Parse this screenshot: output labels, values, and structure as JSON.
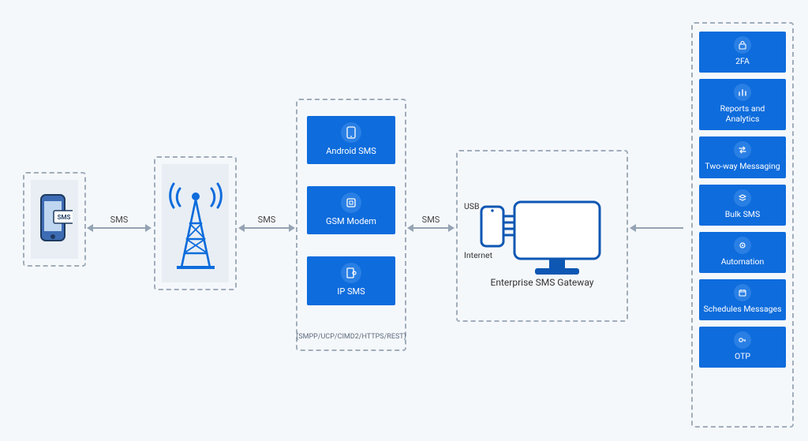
{
  "arrows": {
    "a1": "SMS",
    "a2": "SMS",
    "a3": "SMS"
  },
  "modules": {
    "android": "Android SMS",
    "gsm": "GSM Modem",
    "ipsms": "IP SMS",
    "protocols_note": "(SMPP/UCP/CIMD2/HTTPS/REST)"
  },
  "gateway": {
    "usb": "USB",
    "internet": "Internet",
    "caption": "Enterprise SMS Gateway"
  },
  "features": {
    "f1": "2FA",
    "f2": "Reports and Analytics",
    "f3": "Two-way Messaging",
    "f4": "Bulk SMS",
    "f5": "Automation",
    "f6": "Schedules Messages",
    "f7": "OTP"
  }
}
